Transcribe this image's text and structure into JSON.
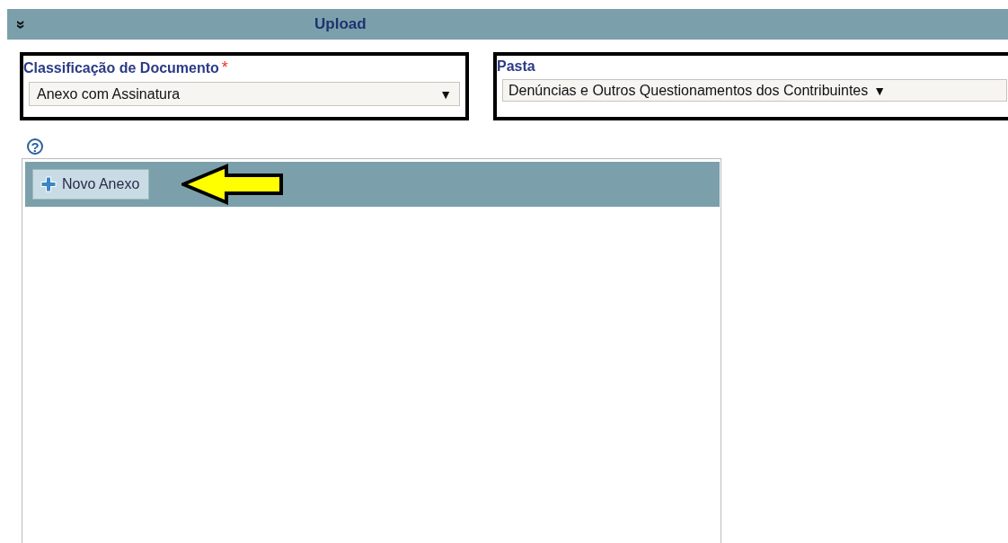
{
  "header": {
    "title": "Upload",
    "toggle": "»",
    "expanded": true
  },
  "fields": [
    {
      "label": "Classificação de Documento",
      "required_mark": "*",
      "value": "Anexo com Assinatura",
      "caret": "▼"
    },
    {
      "label": "Pasta",
      "value": "Denúncias e Outros Questionamentos dos Contribuintes",
      "caret": "▼"
    }
  ],
  "help": "?",
  "attachments": {
    "button": "Novo Anexo"
  }
}
